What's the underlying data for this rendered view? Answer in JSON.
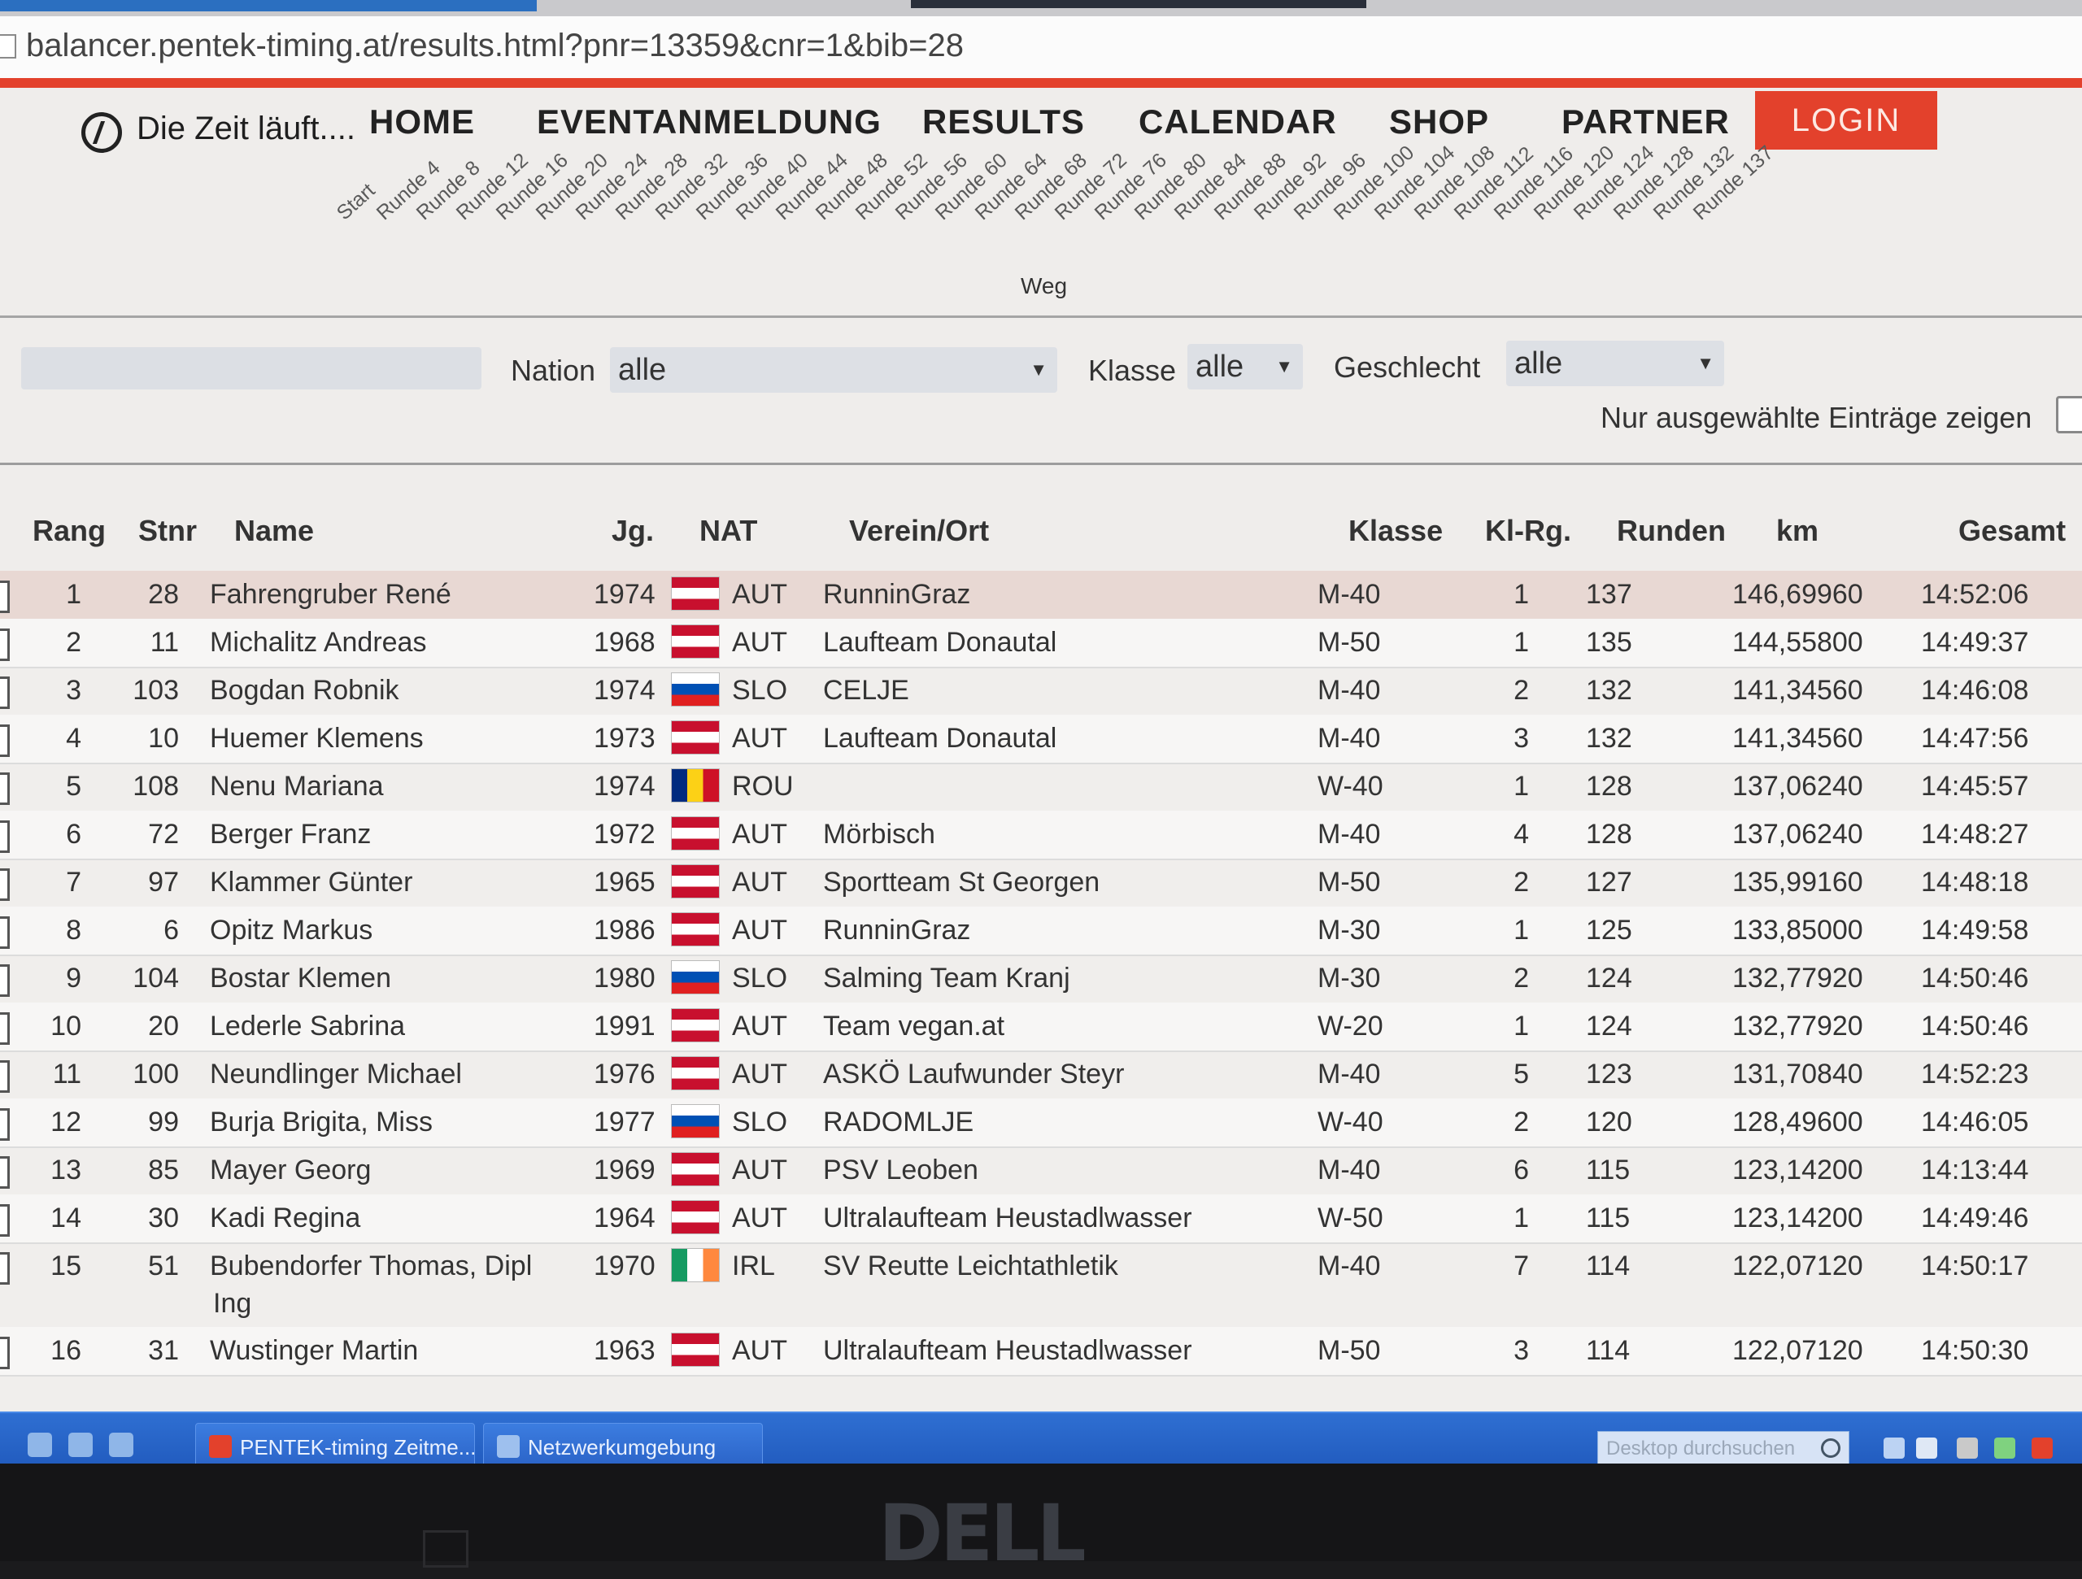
{
  "browser": {
    "url": "balancer.pentek-timing.at/results.html?pnr=13359&cnr=1&bib=28"
  },
  "brand": {
    "text": "Die Zeit läuft...."
  },
  "nav": {
    "items": [
      "HOME",
      "EVENTANMELDUNG",
      "RESULTS",
      "CALENDAR",
      "SHOP",
      "PARTNER"
    ],
    "login": "LOGIN"
  },
  "rounds": {
    "labels": [
      "Start",
      "Runde 4",
      "Runde 8",
      "Runde 12",
      "Runde 16",
      "Runde 20",
      "Runde 24",
      "Runde 28",
      "Runde 32",
      "Runde 36",
      "Runde 40",
      "Runde 44",
      "Runde 48",
      "Runde 52",
      "Runde 56",
      "Runde 60",
      "Runde 64",
      "Runde 68",
      "Runde 72",
      "Runde 76",
      "Runde 80",
      "Runde 84",
      "Runde 88",
      "Runde 92",
      "Runde 96",
      "Runde 100",
      "Runde 104",
      "Runde 108",
      "Runde 112",
      "Runde 116",
      "Runde 120",
      "Runde 124",
      "Runde 128",
      "Runde 132",
      "Runde 137"
    ],
    "axis_label": "Weg"
  },
  "filters": {
    "nation_label": "Nation",
    "nation_value": "alle",
    "klasse_label": "Klasse",
    "klasse_value": "alle",
    "geschlecht_label": "Geschlecht",
    "geschlecht_value": "alle",
    "only_selected_label": "Nur ausgewählte Einträge zeigen"
  },
  "table": {
    "headers": {
      "rang": "Rang",
      "stnr": "Stnr",
      "name": "Name",
      "jg": "Jg.",
      "nat": "NAT",
      "verein": "Verein/Ort",
      "klasse": "Klasse",
      "klrg": "Kl-Rg.",
      "runden": "Runden",
      "km": "km",
      "gesamt": "Gesamt"
    },
    "rows": [
      {
        "rang": "1",
        "stnr": "28",
        "name": "Fahrengruber René",
        "jg": "1974",
        "flag": "aut",
        "nat": "AUT",
        "verein": "RunninGraz",
        "klasse": "M-40",
        "klrg": "1",
        "runden": "137",
        "km": "146,69960",
        "gesamt": "14:52:06"
      },
      {
        "rang": "2",
        "stnr": "11",
        "name": "Michalitz Andreas",
        "jg": "1968",
        "flag": "aut",
        "nat": "AUT",
        "verein": "Laufteam Donautal",
        "klasse": "M-50",
        "klrg": "1",
        "runden": "135",
        "km": "144,55800",
        "gesamt": "14:49:37"
      },
      {
        "rang": "3",
        "stnr": "103",
        "name": "Bogdan Robnik",
        "jg": "1974",
        "flag": "slo",
        "nat": "SLO",
        "verein": "CELJE",
        "klasse": "M-40",
        "klrg": "2",
        "runden": "132",
        "km": "141,34560",
        "gesamt": "14:46:08"
      },
      {
        "rang": "4",
        "stnr": "10",
        "name": "Huemer Klemens",
        "jg": "1973",
        "flag": "aut",
        "nat": "AUT",
        "verein": "Laufteam Donautal",
        "klasse": "M-40",
        "klrg": "3",
        "runden": "132",
        "km": "141,34560",
        "gesamt": "14:47:56"
      },
      {
        "rang": "5",
        "stnr": "108",
        "name": "Nenu Mariana",
        "jg": "1974",
        "flag": "rou",
        "nat": "ROU",
        "verein": "",
        "klasse": "W-40",
        "klrg": "1",
        "runden": "128",
        "km": "137,06240",
        "gesamt": "14:45:57"
      },
      {
        "rang": "6",
        "stnr": "72",
        "name": "Berger Franz",
        "jg": "1972",
        "flag": "aut",
        "nat": "AUT",
        "verein": "Mörbisch",
        "klasse": "M-40",
        "klrg": "4",
        "runden": "128",
        "km": "137,06240",
        "gesamt": "14:48:27"
      },
      {
        "rang": "7",
        "stnr": "97",
        "name": "Klammer Günter",
        "jg": "1965",
        "flag": "aut",
        "nat": "AUT",
        "verein": "Sportteam St Georgen",
        "klasse": "M-50",
        "klrg": "2",
        "runden": "127",
        "km": "135,99160",
        "gesamt": "14:48:18"
      },
      {
        "rang": "8",
        "stnr": "6",
        "name": "Opitz Markus",
        "jg": "1986",
        "flag": "aut",
        "nat": "AUT",
        "verein": "RunninGraz",
        "klasse": "M-30",
        "klrg": "1",
        "runden": "125",
        "km": "133,85000",
        "gesamt": "14:49:58"
      },
      {
        "rang": "9",
        "stnr": "104",
        "name": "Bostar Klemen",
        "jg": "1980",
        "flag": "slo",
        "nat": "SLO",
        "verein": "Salming Team Kranj",
        "klasse": "M-30",
        "klrg": "2",
        "runden": "124",
        "km": "132,77920",
        "gesamt": "14:50:46"
      },
      {
        "rang": "10",
        "stnr": "20",
        "name": "Lederle Sabrina",
        "jg": "1991",
        "flag": "aut",
        "nat": "AUT",
        "verein": "Team vegan.at",
        "klasse": "W-20",
        "klrg": "1",
        "runden": "124",
        "km": "132,77920",
        "gesamt": "14:50:46"
      },
      {
        "rang": "11",
        "stnr": "100",
        "name": "Neundlinger Michael",
        "jg": "1976",
        "flag": "aut",
        "nat": "AUT",
        "verein": "ASKÖ Laufwunder Steyr",
        "klasse": "M-40",
        "klrg": "5",
        "runden": "123",
        "km": "131,70840",
        "gesamt": "14:52:23"
      },
      {
        "rang": "12",
        "stnr": "99",
        "name": "Burja Brigita, Miss",
        "jg": "1977",
        "flag": "slo",
        "nat": "SLO",
        "verein": "RADOMLJE",
        "klasse": "W-40",
        "klrg": "2",
        "runden": "120",
        "km": "128,49600",
        "gesamt": "14:46:05"
      },
      {
        "rang": "13",
        "stnr": "85",
        "name": "Mayer Georg",
        "jg": "1969",
        "flag": "aut",
        "nat": "AUT",
        "verein": "PSV Leoben",
        "klasse": "M-40",
        "klrg": "6",
        "runden": "115",
        "km": "123,14200",
        "gesamt": "14:13:44"
      },
      {
        "rang": "14",
        "stnr": "30",
        "name": "Kadi Regina",
        "jg": "1964",
        "flag": "aut",
        "nat": "AUT",
        "verein": "Ultralaufteam Heustadlwasser",
        "klasse": "W-50",
        "klrg": "1",
        "runden": "115",
        "km": "123,14200",
        "gesamt": "14:49:46"
      },
      {
        "rang": "15",
        "stnr": "51",
        "name": "Bubendorfer Thomas, Dipl",
        "name2": "Ing",
        "jg": "1970",
        "flag": "irl",
        "nat": "IRL",
        "verein": "SV Reutte Leichtathletik",
        "klasse": "M-40",
        "klrg": "7",
        "runden": "114",
        "km": "122,07120",
        "gesamt": "14:50:17"
      },
      {
        "rang": "16",
        "stnr": "31",
        "name": "Wustinger Martin",
        "jg": "1963",
        "flag": "aut",
        "nat": "AUT",
        "verein": "Ultralaufteam Heustadlwasser",
        "klasse": "M-50",
        "klrg": "3",
        "runden": "114",
        "km": "122,07120",
        "gesamt": "14:50:30"
      }
    ]
  },
  "taskbar": {
    "windows": [
      "PENTEK-timing Zeitme...",
      "Netzwerkumgebung"
    ],
    "search_placeholder": "Desktop durchsuchen"
  },
  "monitor": {
    "brand": "DELL"
  },
  "colors": {
    "accent_red": "#e3412c",
    "highlight_row": "#e8d8d3",
    "taskbar_blue": "#2a62c6"
  }
}
